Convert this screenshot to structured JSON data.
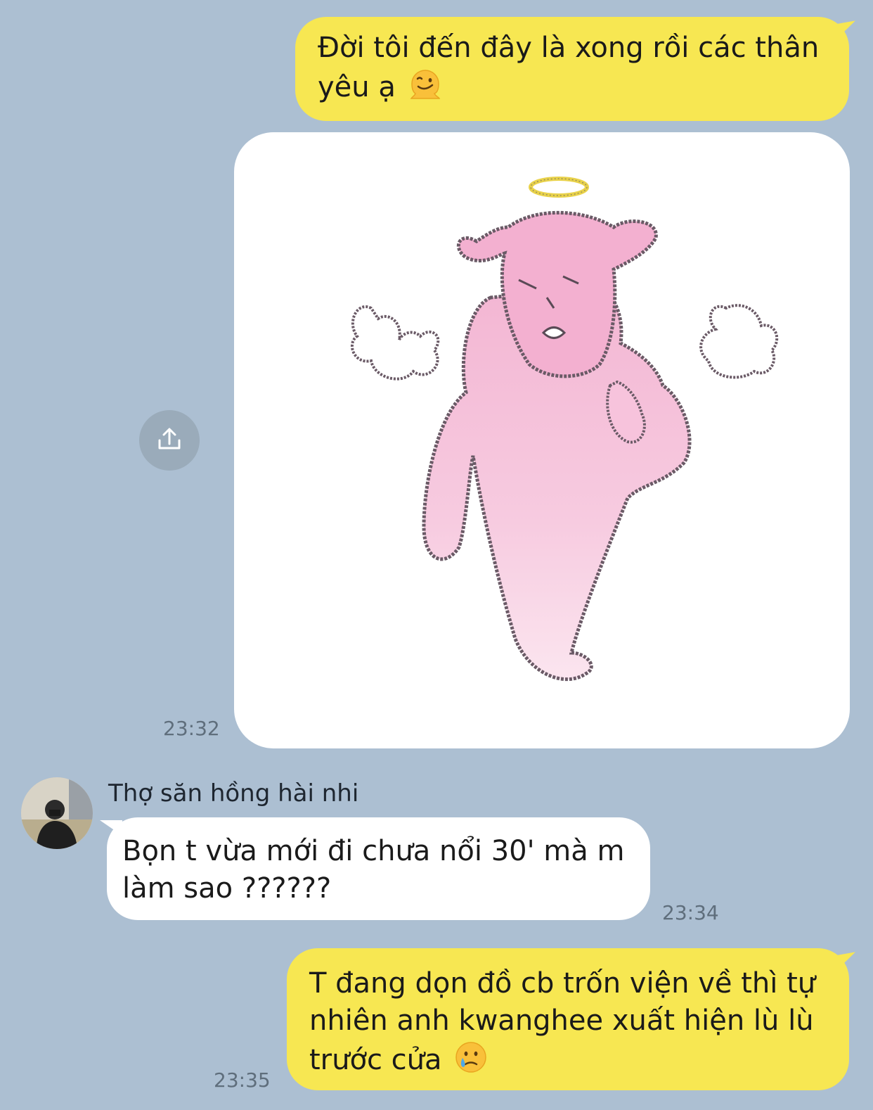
{
  "messages": [
    {
      "direction": "outgoing",
      "text": "Đời tôi đến đây là xong rồi các thân yêu ạ",
      "emoji": "melting-face-icon"
    },
    {
      "direction": "outgoing",
      "type": "sticker",
      "sticker": "pink-ghost-angel-sticker",
      "time": "23:32"
    },
    {
      "direction": "incoming",
      "sender": "Thợ săn hồng hài nhi",
      "text": "Bọn t vừa mới đi chưa nổi 30' mà m làm sao ??????",
      "time": "23:34"
    },
    {
      "direction": "outgoing",
      "text": "T đang dọn đồ cb trốn viện về thì tự nhiên anh kwanghee xuất hiện lù lù trước cửa",
      "emoji": "sad-but-relieved-face-icon",
      "time": "23:35"
    }
  ],
  "colors": {
    "background": "#acbfd2",
    "outgoing_bubble": "#f7e752",
    "incoming_bubble": "#ffffff",
    "timestamp": "#5f6e7c"
  },
  "icons": [
    "share-icon",
    "melting-face-icon",
    "sad-but-relieved-face-icon"
  ]
}
